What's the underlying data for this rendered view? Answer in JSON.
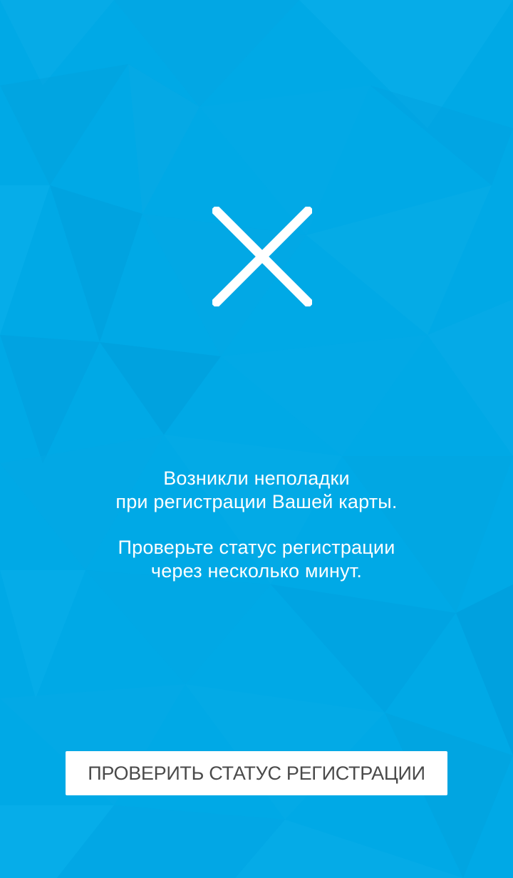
{
  "colors": {
    "background": "#00a9e6",
    "text": "#ffffff",
    "button_background": "#ffffff",
    "button_text": "#4a4a4a"
  },
  "status_icon": "close-icon",
  "message": {
    "line1": "Возникли неполадки",
    "line2": "при регистрации Вашей карты.",
    "line3": "Проверьте статус регистрации",
    "line4": "через несколько минут."
  },
  "button": {
    "label": "ПРОВЕРИТЬ СТАТУС РЕГИСТРАЦИИ"
  }
}
